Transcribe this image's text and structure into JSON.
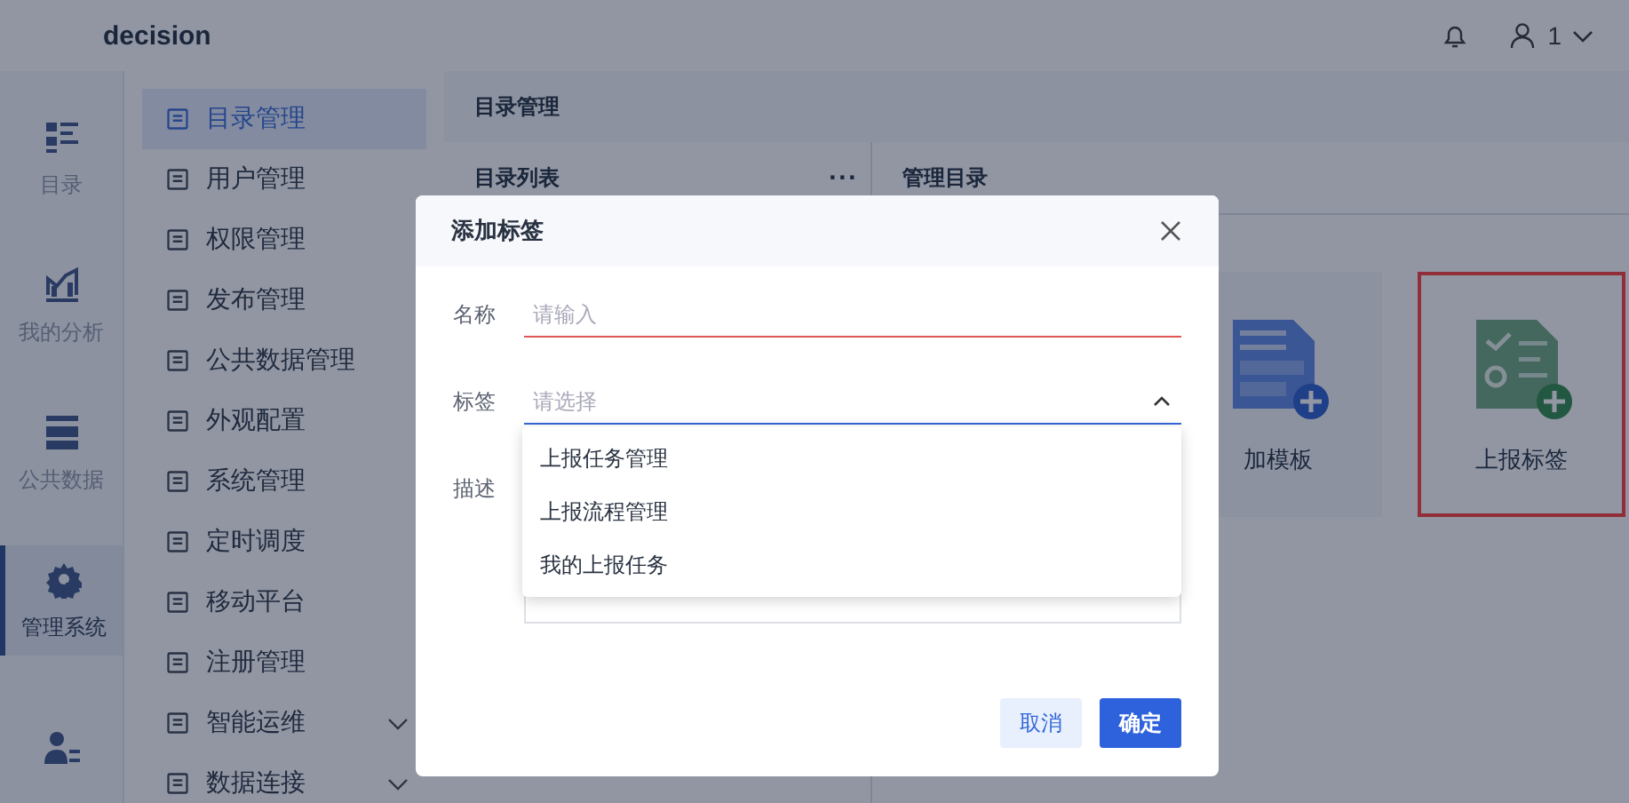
{
  "top_bar": {
    "title": "decision",
    "user": "1"
  },
  "rail": [
    {
      "label": "目录",
      "selected": false
    },
    {
      "label": "我的分析",
      "selected": false
    },
    {
      "label": "公共数据",
      "selected": false
    },
    {
      "label": "管理系统",
      "selected": true
    },
    {
      "selected": false
    }
  ],
  "menu": [
    {
      "label": "目录管理",
      "selected": true,
      "expandable": false
    },
    {
      "label": "用户管理",
      "selected": false,
      "expandable": false
    },
    {
      "label": "权限管理",
      "selected": false,
      "expandable": false
    },
    {
      "label": "发布管理",
      "selected": false,
      "expandable": false
    },
    {
      "label": "公共数据管理",
      "selected": false,
      "expandable": false
    },
    {
      "label": "外观配置",
      "selected": false,
      "expandable": false
    },
    {
      "label": "系统管理",
      "selected": false,
      "expandable": false
    },
    {
      "label": "定时调度",
      "selected": false,
      "expandable": false
    },
    {
      "label": "移动平台",
      "selected": false,
      "expandable": false
    },
    {
      "label": "注册管理",
      "selected": false,
      "expandable": false
    },
    {
      "label": "智能运维",
      "selected": false,
      "expandable": true
    },
    {
      "label": "数据连接",
      "selected": false,
      "expandable": true
    }
  ],
  "page_title": "目录管理",
  "list_panel": {
    "title": "目录列表",
    "more": "···"
  },
  "manage_panel": {
    "title": "管理目录",
    "cards": [
      {
        "label": "加模板",
        "kind": "template",
        "selected": false
      },
      {
        "label": "上报标签",
        "kind": "tag",
        "selected": true
      }
    ]
  },
  "dialog": {
    "title": "添加标签",
    "fields": [
      {
        "kind": "input",
        "label": "名称",
        "placeholder": "请输入",
        "error": true
      },
      {
        "kind": "select",
        "label": "标签",
        "placeholder": "请选择",
        "open": true,
        "options": [
          "上报任务管理",
          "上报流程管理",
          "我的上报任务"
        ]
      },
      {
        "kind": "textarea",
        "label": "描述"
      }
    ],
    "buttons": [
      {
        "label": "取消",
        "primary": false
      },
      {
        "label": "确定",
        "primary": true
      }
    ]
  }
}
